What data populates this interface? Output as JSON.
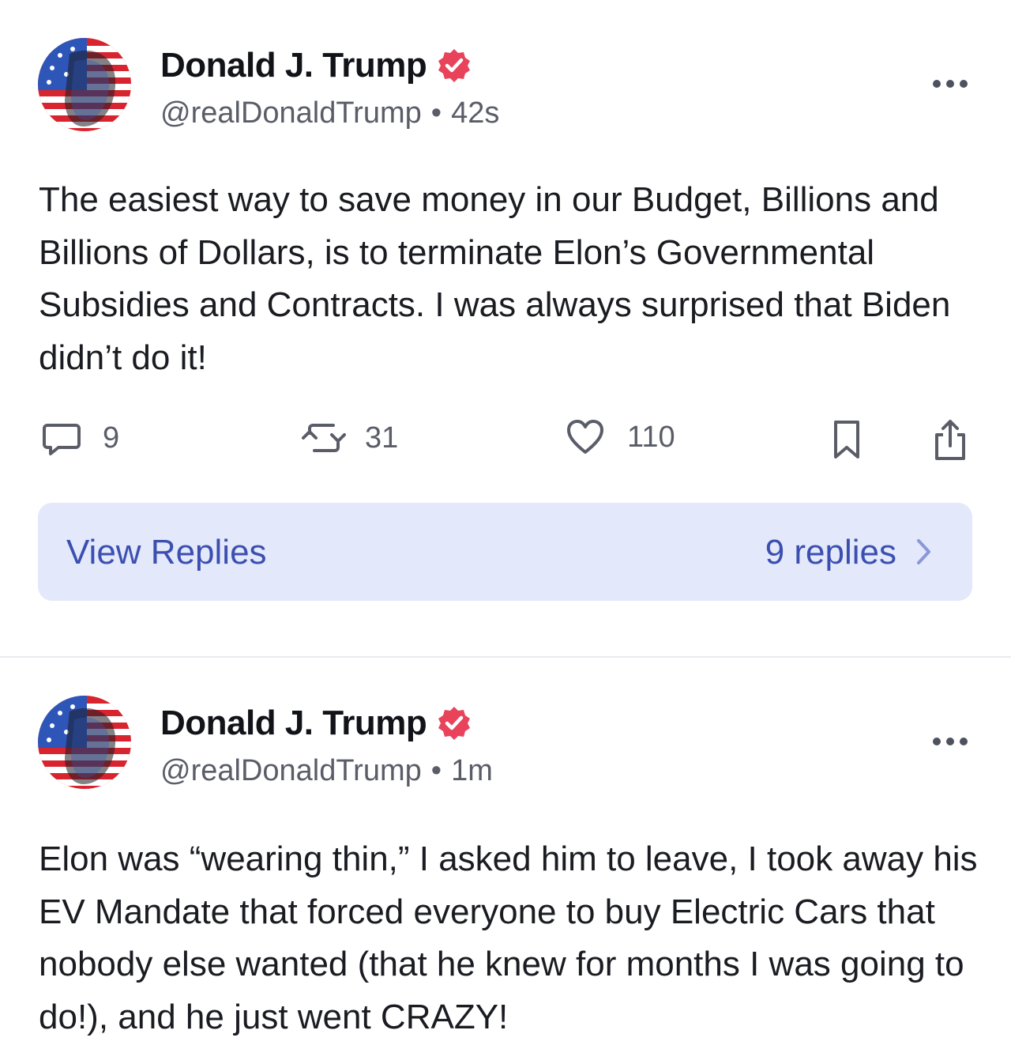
{
  "posts": [
    {
      "author": {
        "display_name": "Donald J. Trump",
        "handle": "@realDonaldTrump",
        "time": "42s",
        "verified": true
      },
      "text": "The easiest way to save money in our Budget, Billions and Billions of Dollars, is to terminate Elon’s Governmental Subsidies and Contracts. I was always surprised that Biden didn’t do it!",
      "stats": {
        "replies": "9",
        "reposts": "31",
        "likes": "110"
      },
      "view_replies": {
        "label": "View Replies",
        "count_label": "9 replies"
      }
    },
    {
      "author": {
        "display_name": "Donald J. Trump",
        "handle": "@realDonaldTrump",
        "time": "1m",
        "verified": true
      },
      "text": "Elon was “wearing thin,” I asked him to leave, I took away his EV Mandate that forced everyone to buy Electric Cars that nobody else wanted (that he knew for months I was going to do!), and he just went CRAZY!"
    }
  ],
  "separator": "•",
  "icons": {
    "verified": "verified-badge-icon",
    "more": "more-options-icon",
    "reply": "reply-icon",
    "repost": "repost-icon",
    "like": "heart-icon",
    "bookmark": "bookmark-icon",
    "share": "share-icon",
    "chevron": "chevron-right-icon"
  },
  "colors": {
    "verified_badge": "#e8435a",
    "replies_bar_bg": "#e3e8fb",
    "replies_bar_text": "#3b4fb0",
    "muted_text": "#5a5d68"
  }
}
